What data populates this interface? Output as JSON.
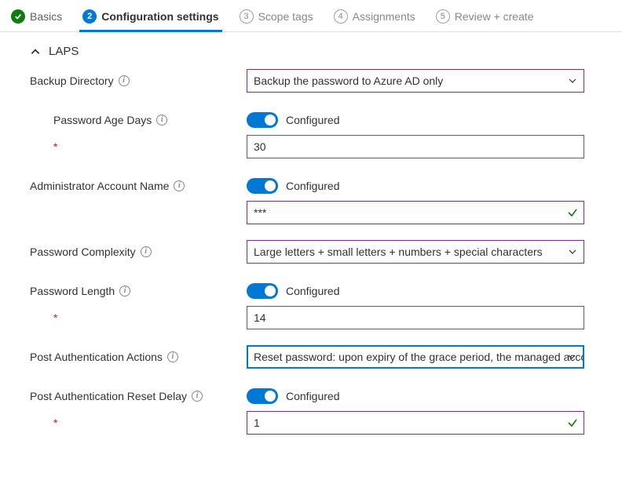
{
  "steps": {
    "s1": "Basics",
    "s2": "Configuration settings",
    "s3": "Scope tags",
    "s4": "Assignments",
    "s5": "Review + create",
    "n3": "3",
    "n4": "4",
    "n5": "5",
    "n2": "2"
  },
  "section_title": "LAPS",
  "labels": {
    "backup_dir": "Backup Directory",
    "pwd_age": "Password Age Days",
    "admin_name": "Administrator Account Name",
    "pwd_complex": "Password Complexity",
    "pwd_len": "Password Length",
    "post_auth_actions": "Post Authentication Actions",
    "post_auth_delay": "Post Authentication Reset Delay",
    "configured": "Configured",
    "req": "*"
  },
  "values": {
    "backup_dir": "Backup the password to Azure AD only",
    "pwd_age": "30",
    "admin_name": "***",
    "pwd_complex": "Large letters + small letters + numbers + special characters",
    "pwd_len": "14",
    "post_auth_actions": "Reset password: upon expiry of the grace period, the managed accou...",
    "post_auth_delay": "1"
  }
}
